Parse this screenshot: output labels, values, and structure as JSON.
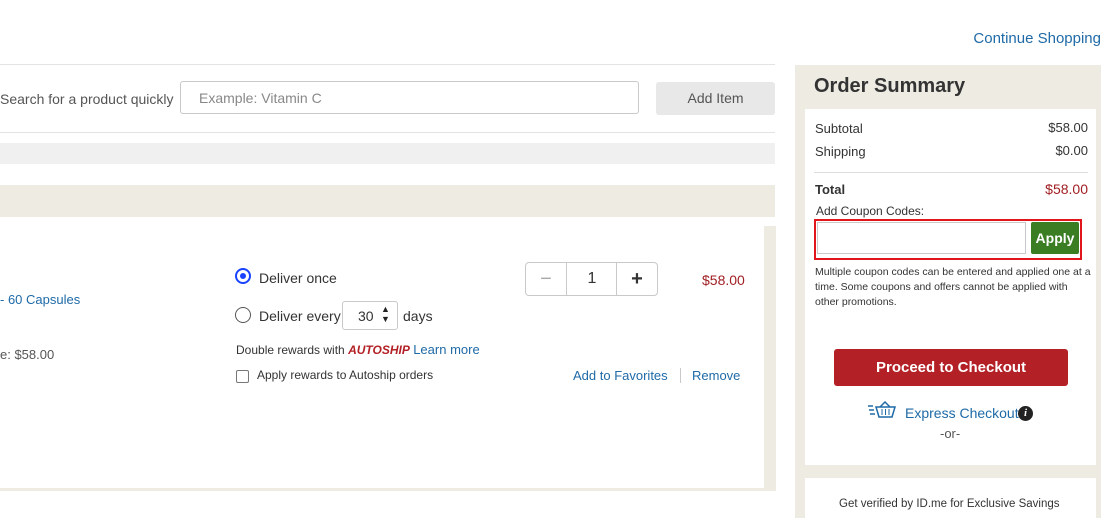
{
  "header": {
    "continue_shopping": "Continue Shopping"
  },
  "quick_add": {
    "label": "Search for a product quickly",
    "placeholder": "Example: Vitamin C",
    "add_button": "Add Item"
  },
  "cart_item": {
    "name_fragment": "- 60 Capsules",
    "price_fragment": "e: $58.00",
    "deliver_once_label": "Deliver once",
    "deliver_every_label": "Deliver every",
    "deliver_every_value": "30",
    "days_label": "days",
    "double_rewards_text": "Double rewards with",
    "autoship_label": "AUTOSHIP",
    "learn_more": "Learn more",
    "apply_rewards_label": "Apply rewards to Autoship orders",
    "quantity": "1",
    "minus_symbol": "−",
    "plus_symbol": "+",
    "line_price": "$58.00",
    "add_to_favorites": "Add to Favorites",
    "remove": "Remove",
    "selected_delivery": "Deliver once"
  },
  "summary": {
    "title": "Order Summary",
    "subtotal_label": "Subtotal",
    "subtotal_value": "$58.00",
    "shipping_label": "Shipping",
    "shipping_value": "$0.00",
    "total_label": "Total",
    "total_value": "$58.00",
    "coupon_label": "Add Coupon Codes:",
    "coupon_value": "",
    "apply_button": "Apply",
    "coupon_note": "Multiple coupon codes can be entered and applied one at a time. Some coupons and offers cannot be applied with other promotions.",
    "checkout_button": "Proceed to Checkout",
    "express_checkout": "Express Checkout",
    "info_symbol": "i",
    "or_text": "-or-",
    "idme_text": "Get verified by ID.me for Exclusive Savings"
  },
  "colors": {
    "link": "#1f6aa7",
    "price_red": "#a11e22",
    "checkout_red": "#b32025",
    "apply_green": "#3b7d23",
    "highlight_border": "#e1161c",
    "panel_beige": "#eeebe3",
    "radio_selected": "#1a43ff"
  },
  "icons": [
    "basket-icon",
    "info-icon",
    "up-down-arrows-icon"
  ]
}
